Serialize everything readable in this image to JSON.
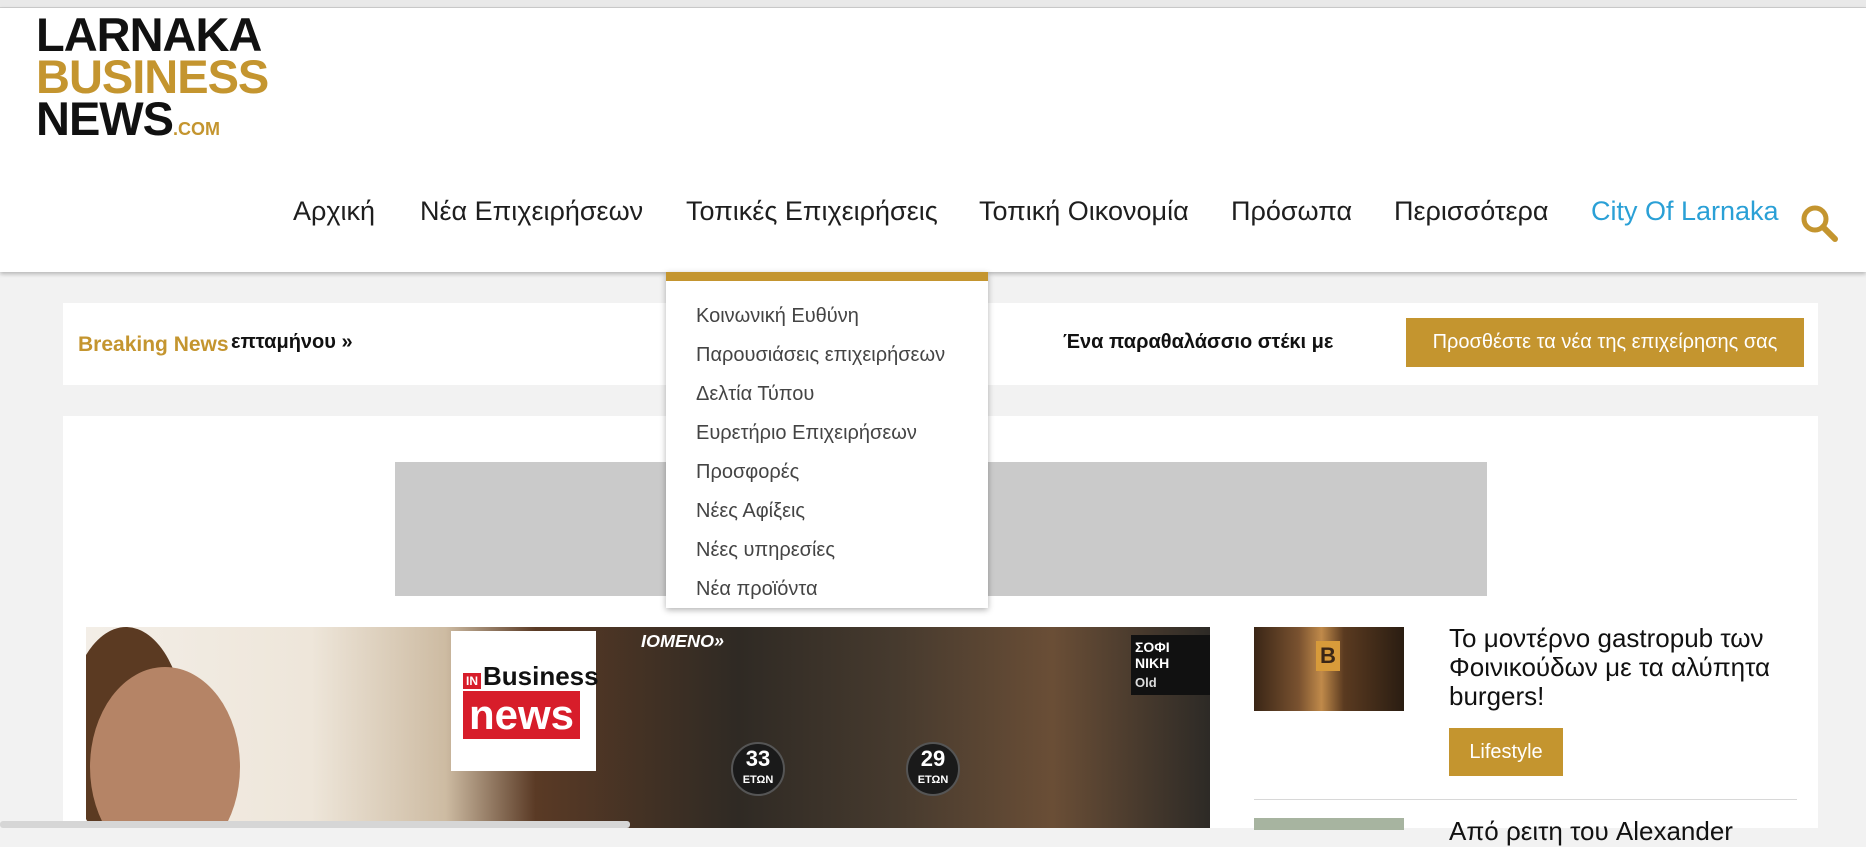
{
  "logo": {
    "line1": "LARNAKA",
    "line2": "BUSINESS",
    "line3": "NEWS",
    "suffix": ".COM"
  },
  "nav": [
    {
      "label": "Αρχική"
    },
    {
      "label": "Νέα Επιχειρήσεων"
    },
    {
      "label": "Τοπικές Επιχειρήσεις"
    },
    {
      "label": "Τοπική Οικονομία"
    },
    {
      "label": "Πρόσωπα"
    },
    {
      "label": "Περισσότερα"
    },
    {
      "label": "City Of Larnaka"
    }
  ],
  "search_icon": "search-icon",
  "dropdown": {
    "items": [
      "Κοινωνική Ευθύνη",
      "Παρουσιάσεις επιχειρήσεων",
      "Δελτία Τύπου",
      "Ευρετήριο Επιχειρήσεων",
      "Προσφορές",
      "Νέες Αφίξεις",
      "Νέες υπηρεσίες",
      "Νέα προϊόντα"
    ]
  },
  "breaking": {
    "label": "Breaking News",
    "ticker_left": "επταμήνου »",
    "ticker_right": "Ένα παραθαλάσσιο στέκι με",
    "add_button": "Προσθέστε τα νέα της επιχείρησης σας"
  },
  "feature_image": {
    "brand_in": "IN",
    "brand_business": "Business",
    "brand_news": "news",
    "badge_left_number": "33",
    "badge_left_word": "ΕΤΩΝ",
    "badge_right_number": "29",
    "badge_right_word": "ΕΤΩΝ",
    "banner_text": "ΙΟΜΕΝΟ»",
    "corner_text": "ΣΟΦΙ ΝΙΚΗ",
    "corner_extra": "Old"
  },
  "sidebar": {
    "item1": {
      "title": "Το μοντέρνο gastropub των Φοινικούδων με τα αλύπητα burgers!",
      "category": "Lifestyle"
    },
    "item2": {
      "title": "Από ρειτη του Alexander"
    }
  },
  "colors": {
    "accent": "#c4952f",
    "link_city": "#2aa0d6"
  }
}
